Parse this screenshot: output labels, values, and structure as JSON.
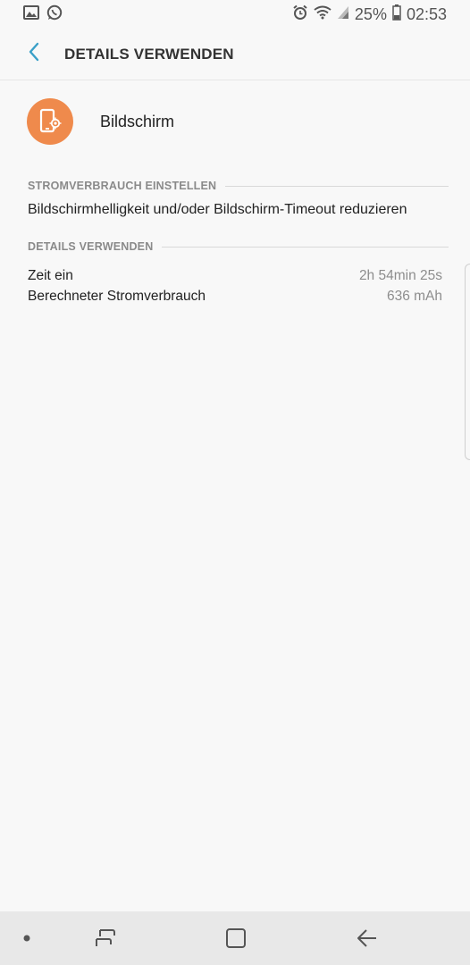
{
  "status_bar": {
    "battery_percent": "25%",
    "time": "02:53",
    "icons": [
      "image-icon",
      "whatsapp-icon",
      "alarm-icon",
      "wifi-icon",
      "signal-icon",
      "battery-icon"
    ]
  },
  "header": {
    "title": "DETAILS VERWENDEN"
  },
  "app": {
    "name": "Bildschirm",
    "icon": "screen-brightness-icon",
    "icon_color": "#ef8a4c"
  },
  "sections": {
    "power": {
      "header": "STROMVERBRAUCH EINSTELLEN",
      "hint": "Bildschirmhelligkeit und/oder Bildschirm-Timeout reduzieren"
    },
    "usage": {
      "header": "DETAILS VERWENDEN",
      "rows": [
        {
          "label": "Zeit ein",
          "value": "2h 54min 25s"
        },
        {
          "label": "Berechneter Stromverbrauch",
          "value": "636 mAh"
        }
      ]
    }
  },
  "nav_bar": {
    "icons": [
      "dot-icon",
      "recent-apps-icon",
      "home-icon",
      "back-arrow-icon"
    ]
  },
  "colors": {
    "accent": "#3aa0c8",
    "background": "#f8f8f8"
  }
}
